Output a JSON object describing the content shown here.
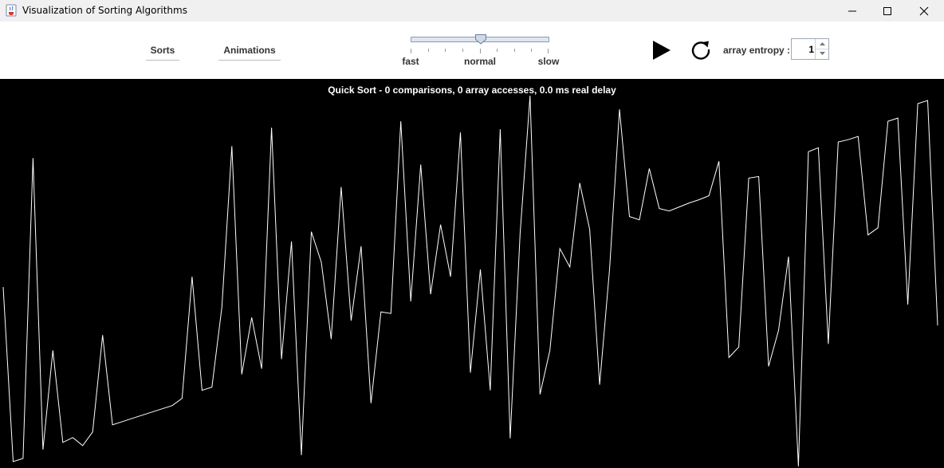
{
  "window": {
    "title": "Visualization of Sorting Algorithms",
    "icons": {
      "app": "java-cup-icon",
      "minimize": "minimize-icon",
      "maximize": "maximize-icon",
      "close": "close-icon"
    }
  },
  "toolbar": {
    "sorts_label": "Sorts",
    "animations_label": "Animations",
    "speed_slider": {
      "labels": [
        "fast",
        "normal",
        "slow"
      ],
      "value_fraction": 0.5
    },
    "play_icon": "play-icon",
    "reset_icon": "reset-icon",
    "entropy_label": "array entropy :",
    "entropy_value": "1"
  },
  "status": {
    "text": "Quick Sort - 0 comparisons, 0 array accesses, 0.0 ms real delay"
  },
  "visualization": {
    "max_value": 460,
    "line_color": "#ffffff",
    "background": "#000000",
    "values": [
      225,
      7,
      11,
      386,
      22,
      146,
      31,
      37,
      27,
      44,
      165,
      53,
      57,
      61,
      65,
      69,
      73,
      77,
      86,
      238,
      96,
      100,
      200,
      401,
      116,
      187,
      123,
      424,
      135,
      282,
      15,
      294,
      256,
      160,
      350,
      183,
      276,
      80,
      194,
      192,
      432,
      207,
      378,
      216,
      303,
      238,
      418,
      118,
      247,
      96,
      422,
      36,
      291,
      464,
      91,
      146,
      273,
      250,
      355,
      297,
      103,
      248,
      447,
      313,
      309,
      373,
      323,
      320,
      325,
      330,
      334,
      339,
      382,
      137,
      150,
      361,
      363,
      126,
      171,
      263,
      1,
      394,
      399,
      154,
      406,
      409,
      413,
      290,
      299,
      432,
      436,
      203,
      454,
      458,
      177
    ]
  }
}
